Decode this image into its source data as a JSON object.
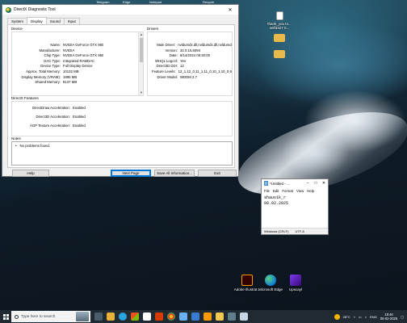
{
  "top_strip": [
    "",
    "",
    "",
    "Telegram",
    "Edge",
    "Notepad",
    "",
    "Recycle",
    "",
    "",
    "",
    "",
    "",
    "",
    ""
  ],
  "desktop_icons": {
    "right_top": [
      {
        "label": "thank_you to... self3327 0...",
        "icon": "document-icon"
      },
      {
        "label": "",
        "icon": "folder-icon"
      },
      {
        "label": "",
        "icon": "folder-icon"
      }
    ],
    "bottom": [
      {
        "label": "Adobe Illustrat...",
        "icon": "adobe-illustrator-icon"
      },
      {
        "label": "Microsoft Edge",
        "icon": "edge-icon"
      },
      {
        "label": "Upscayl",
        "icon": "upscayl-icon"
      }
    ]
  },
  "dxdiag": {
    "title": "DirectX Diagnostic Tool",
    "tabs": [
      "System",
      "Display",
      "Sound",
      "Input"
    ],
    "active_tab": "Display",
    "device": {
      "title": "Device",
      "rows": [
        {
          "k": "Name:",
          "v": "NVIDIA GeForce GTX 950"
        },
        {
          "k": "Manufacturer:",
          "v": "NVIDIA"
        },
        {
          "k": "Chip Type:",
          "v": "NVIDIA GeForce GTX 950"
        },
        {
          "k": "DAC Type:",
          "v": "Integrated RAMDAC"
        },
        {
          "k": "Device Type:",
          "v": "Full Display Device"
        },
        {
          "k": "Approx. Total Memory:",
          "v": "10132 MB"
        },
        {
          "k": "Display Memory (VRAM):",
          "v": "1995 MB"
        },
        {
          "k": "Shared Memory:",
          "v": "8137 MB"
        }
      ]
    },
    "drivers": {
      "title": "Drivers",
      "rows": [
        {
          "k": "Main Driver:",
          "v": "nvldumdx.dll,nvldumdx.dll,nvldumdx.d"
        },
        {
          "k": "Version:",
          "v": "32.0.15.6094"
        },
        {
          "k": "Date:",
          "v": "8/14/2024 05:30:00"
        },
        {
          "k": "WHQL Logo'd:",
          "v": "Yes"
        },
        {
          "k": "Direct3D DDI:",
          "v": "12"
        },
        {
          "k": "Feature Levels:",
          "v": "12_1,12_0,11_1,11_0,10_1,10_0,9_3"
        },
        {
          "k": "Driver Model:",
          "v": "WDDM 2.7"
        }
      ]
    },
    "features": {
      "title": "DirectX Features",
      "rows": [
        {
          "k": "DirectDraw Acceleration:",
          "v": "Enabled"
        },
        {
          "k": "Direct3D Acceleration:",
          "v": "Enabled"
        },
        {
          "k": "AGP Texture Acceleration:",
          "v": "Enabled"
        }
      ]
    },
    "notes": {
      "title": "Notes",
      "items": [
        "No problems found."
      ]
    },
    "buttons": {
      "help": "Help",
      "next": "Next Page",
      "save": "Save All Information...",
      "exit": "Exit"
    }
  },
  "notepad": {
    "title": "*Untitled - ...",
    "menu": [
      "File",
      "Edit",
      "Format",
      "View",
      "Help"
    ],
    "lines": [
      "shauvik_r",
      "08.02.2025"
    ],
    "status": [
      "Windows (CRLF)",
      "UTF-8"
    ]
  },
  "taskbar": {
    "search_placeholder": "Type here to search",
    "weather": "28°C",
    "language": "ENG",
    "time": "19:46",
    "date": "08-02-2025"
  }
}
